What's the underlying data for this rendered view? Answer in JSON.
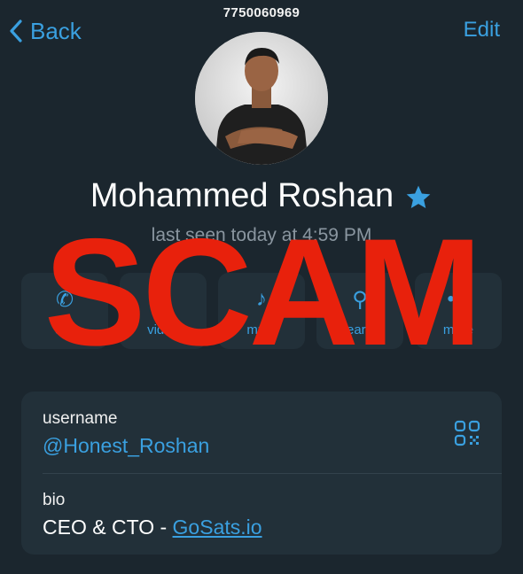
{
  "header": {
    "phone": "7750060969",
    "back_label": "Back",
    "edit_label": "Edit"
  },
  "profile": {
    "name": "Mohammed Roshan",
    "last_seen": "last seen today at 4:59 PM"
  },
  "actions": [
    {
      "label": "call",
      "icon": "phone-icon"
    },
    {
      "label": "video",
      "icon": "video-icon"
    },
    {
      "label": "mute",
      "icon": "bell-icon"
    },
    {
      "label": "search",
      "icon": "search-icon"
    },
    {
      "label": "more",
      "icon": "ellipsis-icon"
    }
  ],
  "overlay": {
    "stamp": "SCAM",
    "color": "#e8210c"
  },
  "info": {
    "username_label": "username",
    "username_value": "@Honest_Roshan",
    "bio_label": "bio",
    "bio_text": "CEO & CTO - ",
    "bio_link": "GoSats.io"
  },
  "colors": {
    "background": "#1b262e",
    "card": "#223039",
    "accent": "#3aa0e0",
    "muted": "#8a96a0"
  }
}
